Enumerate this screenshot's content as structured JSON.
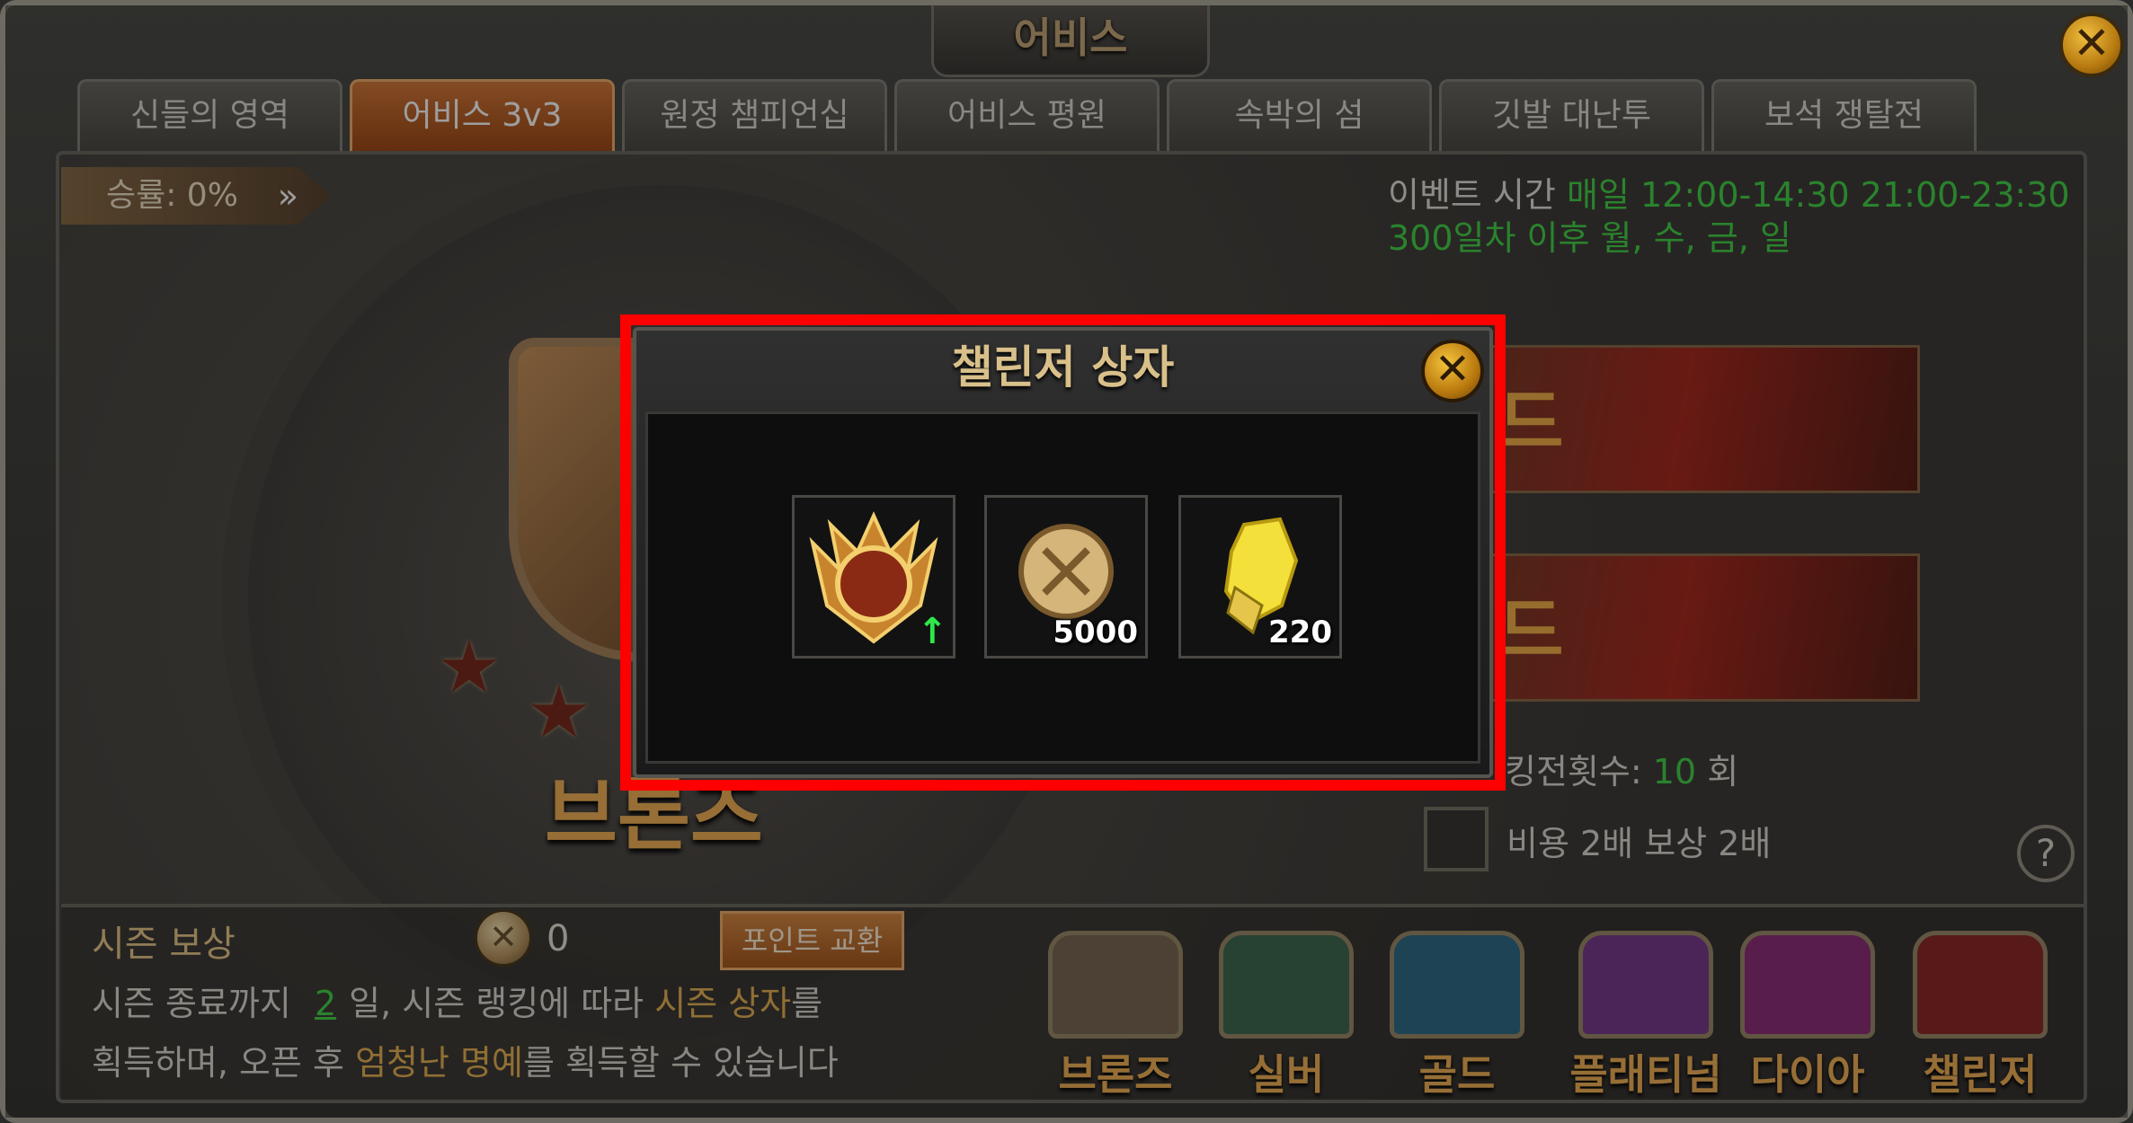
{
  "window": {
    "title": "어비스",
    "close_icon": "close-icon"
  },
  "tabs": [
    {
      "label": "신들의 영역",
      "active": false
    },
    {
      "label": "어비스 3v3",
      "active": true
    },
    {
      "label": "원정 챔피언십",
      "active": false
    },
    {
      "label": "어비스 평원",
      "active": false
    },
    {
      "label": "속박의 섬",
      "active": false
    },
    {
      "label": "깃발 대난투",
      "active": false
    },
    {
      "label": "보석 쟁탈전",
      "active": false
    }
  ],
  "winrate": {
    "label": "승률: 0%",
    "arrow": "»"
  },
  "event": {
    "label": "이벤트 시간",
    "times": "매일 12:00-14:30 21:00-23:30",
    "days": "300일차 이후 월, 수, 금, 일"
  },
  "rank": {
    "name": "브론즈"
  },
  "banners": [
    {
      "text": "드"
    },
    {
      "text": "드"
    }
  ],
  "ranking": {
    "label": "킹전횟수:",
    "count": "10",
    "unit": "회"
  },
  "double_option": {
    "label": "비용 2배 보상 2배"
  },
  "help_label": "?",
  "season": {
    "title": "시즌 보상",
    "coin_count": "0",
    "exchange_button": "포인트 교환",
    "line1_a": "시즌 종료까지",
    "line1_days": "2",
    "line1_b": "일, 시즌 랭킹에 따라",
    "line1_c": "시즌 상자",
    "line1_d": "를",
    "line2_a": "획득하며, 오픈 후",
    "line2_b": "엄청난 명예",
    "line2_c": "를 획득할 수 있습니다"
  },
  "chests": [
    {
      "label": "브론즈",
      "color": "#7b6a55"
    },
    {
      "label": "실버",
      "color": "#3f6a52"
    },
    {
      "label": "골드",
      "color": "#2f6c88"
    },
    {
      "label": "플래티넘",
      "color": "#7a3d8e"
    },
    {
      "label": "다이아",
      "color": "#8e2f7a"
    },
    {
      "label": "챌린저",
      "color": "#8e2a28"
    }
  ],
  "modal": {
    "title": "챌린저 상자",
    "items": [
      {
        "icon": "challenger-emblem-icon",
        "qty": "",
        "badge": "↑"
      },
      {
        "icon": "honor-coin-icon",
        "qty": "5000"
      },
      {
        "icon": "yellow-crystal-icon",
        "qty": "220"
      }
    ]
  }
}
